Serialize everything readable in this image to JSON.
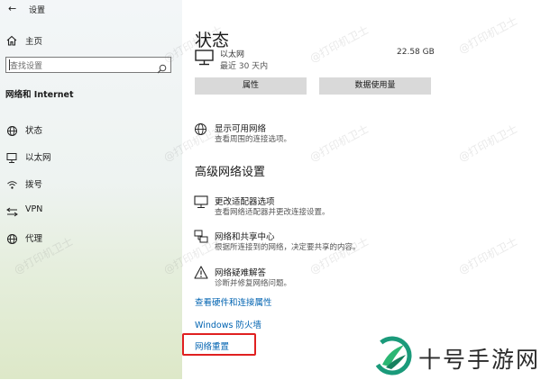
{
  "window": {
    "title": "设置"
  },
  "sidebar": {
    "home_label": "主页",
    "search_placeholder": "查找设置",
    "section_label": "网络和 Internet",
    "items": [
      {
        "icon": "globe-status-icon",
        "label": "状态"
      },
      {
        "icon": "ethernet-icon",
        "label": "以太网"
      },
      {
        "icon": "dialup-icon",
        "label": "拨号"
      },
      {
        "icon": "vpn-icon",
        "label": "VPN"
      },
      {
        "icon": "proxy-globe-icon",
        "label": "代理"
      }
    ]
  },
  "main": {
    "title": "状态",
    "ethernet": {
      "name": "以太网",
      "subtitle": "最近 30 天内",
      "data_used": "22.58 GB"
    },
    "buttons": {
      "properties": "属性",
      "data_usage": "数据使用量"
    },
    "show_networks": {
      "title": "显示可用网络",
      "desc": "查看周围的连接选项。"
    },
    "advanced_heading": "高级网络设置",
    "options": [
      {
        "icon": "adapter-icon",
        "title": "更改适配器选项",
        "desc": "查看网络适配器并更改连接设置。"
      },
      {
        "icon": "sharing-center-icon",
        "title": "网络和共享中心",
        "desc": "根据所连接到的网络，决定要共享的内容。"
      },
      {
        "icon": "warning-icon",
        "title": "网络疑难解答",
        "desc": "诊断并修复网络问题。"
      }
    ],
    "links": {
      "hardware": "查看硬件和连接属性",
      "firewall": "Windows 防火墙",
      "reset": "网络重置"
    }
  },
  "watermark": "@打印机卫士",
  "brand": {
    "text": "十号手游网",
    "color": "#1a9a7a"
  },
  "colors": {
    "accent_link": "#0063b1",
    "highlight": "#e02020",
    "button_bg": "#d9d9d9"
  }
}
